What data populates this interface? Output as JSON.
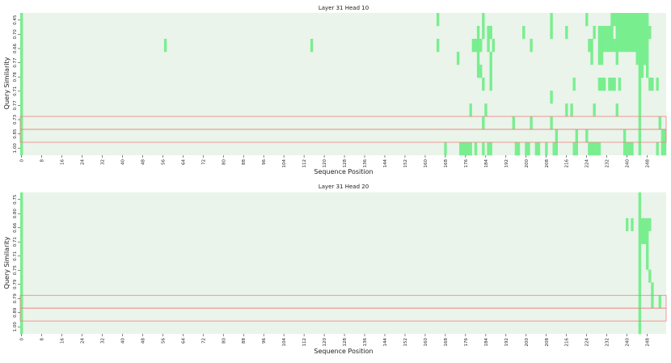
{
  "chart_data": [
    {
      "type": "heatmap",
      "title": "Layer 31 Head 10",
      "xlabel": "Sequence Position",
      "ylabel": "Query Similarity",
      "x_range": [
        0,
        256
      ],
      "x_ticks": [
        0,
        8,
        16,
        24,
        32,
        40,
        48,
        56,
        64,
        72,
        80,
        88,
        96,
        104,
        112,
        120,
        128,
        136,
        144,
        152,
        160,
        168,
        176,
        184,
        192,
        200,
        208,
        216,
        224,
        232,
        240,
        248
      ],
      "y_tick_labels": [
        "0.45",
        "0.70",
        "0.66",
        "0.77",
        "0.78",
        "0.71",
        "0.77",
        "0.73",
        "0.85",
        "1.00"
      ],
      "highlighted_rows": [
        8,
        9
      ],
      "background_color": "#eaf4ea",
      "active_color": "#79ee8f",
      "highlight_color": "#f08080",
      "active_cells": [
        {
          "row": 0,
          "x": [
            0,
            165,
            183,
            210,
            224,
            234,
            235,
            236,
            237,
            238,
            239,
            240,
            241,
            242,
            243,
            244,
            245,
            246,
            247,
            248
          ]
        },
        {
          "row": 1,
          "x": [
            0,
            181,
            183,
            185,
            186,
            199,
            210,
            216,
            227,
            229,
            230,
            231,
            232,
            233,
            234,
            236,
            237,
            238,
            239,
            240,
            241,
            242,
            243,
            244,
            245,
            246,
            247,
            248,
            249
          ]
        },
        {
          "row": 2,
          "x": [
            0,
            57,
            115,
            165,
            179,
            180,
            181,
            182,
            185,
            187,
            202,
            225,
            226,
            229,
            230,
            231,
            232,
            233,
            234,
            235,
            236,
            237,
            238,
            239,
            240,
            241,
            242,
            243,
            244,
            245,
            246,
            247,
            248
          ]
        },
        {
          "row": 3,
          "x": [
            0,
            173,
            181,
            186,
            226,
            229,
            230,
            236,
            244,
            245,
            246,
            247,
            248
          ]
        },
        {
          "row": 4,
          "x": [
            0,
            181,
            182,
            186,
            245,
            246,
            248
          ]
        },
        {
          "row": 5,
          "x": [
            0,
            183,
            186,
            219,
            229,
            230,
            231,
            233,
            234,
            235,
            237,
            245,
            249,
            250,
            252
          ]
        },
        {
          "row": 6,
          "x": [
            0,
            210,
            245
          ]
        },
        {
          "row": 7,
          "x": [
            0,
            178,
            184,
            216,
            218,
            227,
            236,
            245
          ]
        },
        {
          "row": 8,
          "x": [
            0,
            183,
            195,
            202,
            210,
            245,
            253
          ]
        },
        {
          "row": 9,
          "x": [
            0,
            212,
            220,
            224,
            239,
            245,
            254,
            255
          ]
        },
        {
          "row": 10,
          "x": [
            0,
            168,
            174,
            175,
            176,
            177,
            178,
            180,
            183,
            185,
            186,
            196,
            197,
            200,
            201,
            204,
            205,
            208,
            211,
            212,
            219,
            220,
            225,
            226,
            227,
            228,
            229,
            239,
            240,
            241,
            242,
            245,
            252,
            254,
            255
          ]
        }
      ],
      "row_count": 11
    },
    {
      "type": "heatmap",
      "title": "Layer 31 Head 20",
      "xlabel": "Sequence Position",
      "ylabel": "Query Similarity",
      "x_range": [
        0,
        256
      ],
      "x_ticks": [
        0,
        8,
        16,
        24,
        32,
        40,
        48,
        56,
        64,
        72,
        80,
        88,
        96,
        104,
        112,
        120,
        128,
        136,
        144,
        152,
        160,
        168,
        176,
        184,
        192,
        200,
        208,
        216,
        224,
        232,
        240,
        248
      ],
      "y_tick_labels": [
        "0.75",
        "0.80",
        "0.66",
        "0.71",
        "0.71",
        "0.75",
        "0.79",
        "0.79",
        "0.89",
        "1.00"
      ],
      "highlighted_rows": [
        8,
        9
      ],
      "background_color": "#eaf4ea",
      "active_color": "#79ee8f",
      "highlight_color": "#f08080",
      "active_cells": [
        {
          "row": 0,
          "x": [
            0,
            245
          ]
        },
        {
          "row": 1,
          "x": [
            0,
            245
          ]
        },
        {
          "row": 2,
          "x": [
            0,
            240,
            242,
            245,
            246,
            247,
            248,
            249
          ]
        },
        {
          "row": 3,
          "x": [
            0,
            245,
            246,
            247,
            248
          ]
        },
        {
          "row": 4,
          "x": [
            0,
            245,
            248
          ]
        },
        {
          "row": 5,
          "x": [
            0,
            245,
            248
          ]
        },
        {
          "row": 6,
          "x": [
            0,
            245,
            249
          ]
        },
        {
          "row": 7,
          "x": [
            0,
            245,
            250
          ]
        },
        {
          "row": 8,
          "x": [
            0,
            245,
            250,
            253
          ]
        },
        {
          "row": 9,
          "x": [
            0,
            245
          ]
        },
        {
          "row": 10,
          "x": [
            0,
            245
          ]
        }
      ],
      "row_count": 11
    }
  ]
}
